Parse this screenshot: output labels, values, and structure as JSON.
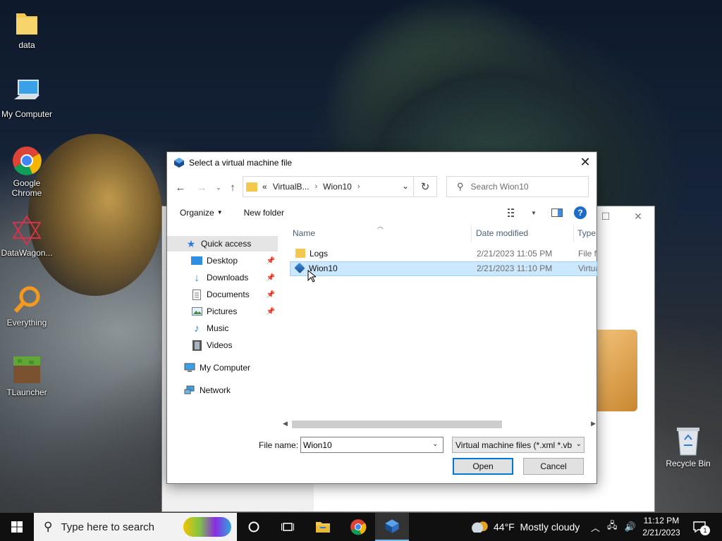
{
  "desktop": {
    "icons": [
      {
        "label": "data"
      },
      {
        "label": "My Computer"
      },
      {
        "label": "Google Chrome"
      },
      {
        "label": "DataWagon..."
      },
      {
        "label": "Everything"
      },
      {
        "label": "TLauncher"
      }
    ],
    "recycle_bin": "Recycle Bin"
  },
  "dialog": {
    "title": "Select a virtual machine file",
    "breadcrumb": {
      "prefix": "«",
      "items": [
        "VirtualB...",
        "Wion10"
      ]
    },
    "search_placeholder": "Search Wion10",
    "toolbar": {
      "organize": "Organize",
      "new_folder": "New folder"
    },
    "nav": {
      "quick_access": "Quick access",
      "items": [
        "Desktop",
        "Downloads",
        "Documents",
        "Pictures",
        "Music",
        "Videos"
      ],
      "my_computer": "My Computer",
      "network": "Network"
    },
    "columns": [
      "Name",
      "Date modified",
      "Type"
    ],
    "files": [
      {
        "name": "Logs",
        "date": "2/21/2023 11:05 PM",
        "type": "File fo"
      },
      {
        "name": "Wion10",
        "date": "2/21/2023 11:10 PM",
        "type": "Virtua"
      }
    ],
    "file_name_label": "File name:",
    "file_name_value": "Wion10",
    "file_type": "Virtual machine files (*.xml *.vb",
    "open_label": "Open",
    "cancel_label": "Cancel"
  },
  "taskbar": {
    "search_placeholder": "Type here to search",
    "weather": "44°F  Mostly cloudy",
    "time": "11:12 PM",
    "date": "2/21/2023",
    "notification_count": "1"
  },
  "colors": {
    "accent": "#0078d7",
    "selection": "#cce8ff",
    "folder": "#f3c84f"
  }
}
